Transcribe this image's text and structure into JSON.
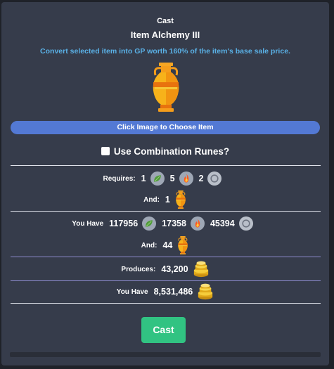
{
  "spell": {
    "cast_label": "Cast",
    "name": "Item Alchemy III",
    "description": "Convert selected item into GP worth 160% of the item's base sale price."
  },
  "item_icon": "amphora-icon",
  "choose_button": "Click Image to Choose Item",
  "combination_runes": {
    "label": "Use Combination Runes?",
    "checked": false
  },
  "requires": {
    "label": "Requires:",
    "runes": [
      {
        "count": "1",
        "icon": "nature-rune-icon"
      },
      {
        "count": "5",
        "icon": "fire-rune-icon"
      },
      {
        "count": "2",
        "icon": "blank-rune-icon"
      }
    ],
    "and_label": "And:",
    "item_count": "1"
  },
  "you_have": {
    "label": "You Have",
    "runes": [
      {
        "count": "117956",
        "icon": "nature-rune-icon"
      },
      {
        "count": "17358",
        "icon": "fire-rune-icon"
      },
      {
        "count": "45394",
        "icon": "blank-rune-icon"
      }
    ],
    "and_label": "And:",
    "item_count": "44"
  },
  "produces": {
    "label": "Produces:",
    "value": "43,200",
    "icon": "gold-coins-icon"
  },
  "gp_have": {
    "label": "You Have",
    "value": "8,531,486",
    "icon": "gold-coins-icon"
  },
  "cast_button": "Cast",
  "colors": {
    "panel": "#363c4b",
    "accent_blue": "#5379d4",
    "description": "#5ab1e6",
    "cast_green": "#31c382"
  }
}
